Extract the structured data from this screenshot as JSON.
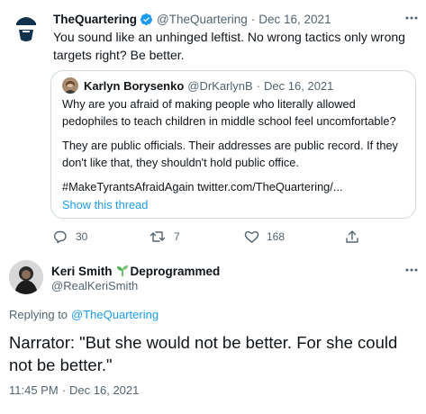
{
  "parent_tweet": {
    "author_name": "TheQuartering",
    "handle": "@TheQuartering",
    "separator": "·",
    "date": "Dec 16, 2021",
    "text": "You sound like an unhinged leftist. No wrong tactics only wrong targets right? Be better.",
    "quoted": {
      "author_name": "Karlyn Borysenko",
      "handle": "@DrKarlynB",
      "separator": "·",
      "date": "Dec 16, 2021",
      "para1": "Why are you afraid of making people who literally allowed pedophiles to teach children in middle school feel uncomfortable?",
      "para2": "They are public officials. Their addresses are public record. If they don't like that, they shouldn't hold public office.",
      "para3": "#MakeTyrantsAfraidAgain twitter.com/TheQuartering/...",
      "show_thread": "Show this thread"
    },
    "actions": {
      "reply_count": "30",
      "retweet_count": "7",
      "like_count": "168"
    }
  },
  "main_tweet": {
    "author_name": "Keri Smith",
    "name_suffix": "Deprogrammed",
    "handle": "@RealKeriSmith",
    "replying_prefix": "Replying to",
    "replying_to": "@TheQuartering",
    "text": "Narrator: \"But she would not be better. For she could not be better.\"",
    "time": "11:45 PM",
    "separator": "·",
    "date": "Dec 16, 2021"
  },
  "colors": {
    "accent": "#1d9bf0",
    "muted": "#536471",
    "text": "#0f1419",
    "border": "#cfd9de",
    "sprout": "#4caf50"
  },
  "icons": [
    "verified-badge-icon",
    "more-icon",
    "reply-icon",
    "retweet-icon",
    "like-icon",
    "share-icon",
    "sprout-icon"
  ]
}
